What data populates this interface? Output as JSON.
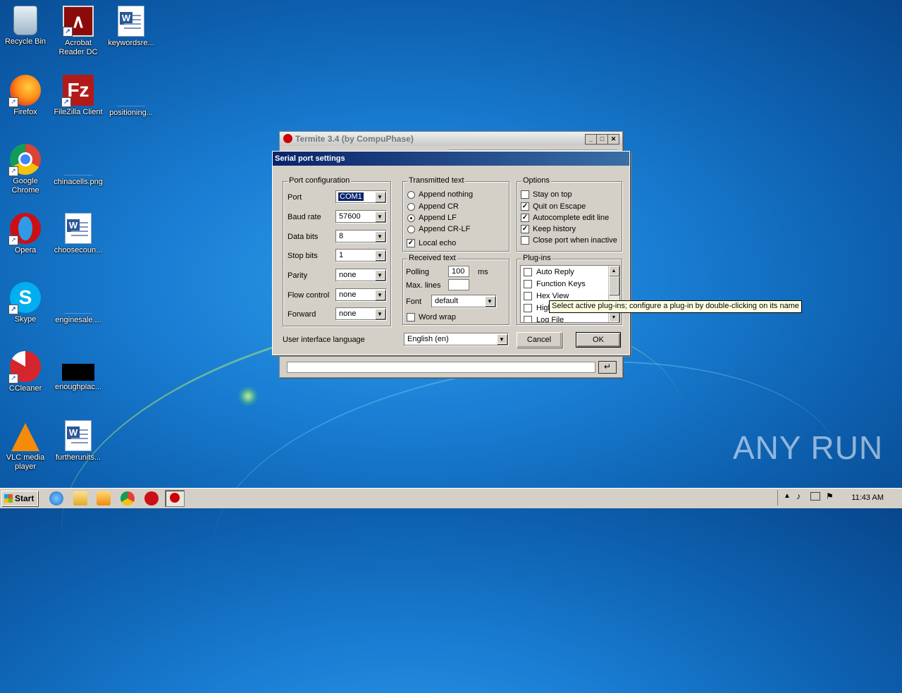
{
  "desktop": {
    "icons": [
      {
        "label": "Recycle Bin",
        "icon": "recycle-bin-icon"
      },
      {
        "label": "Acrobat Reader DC",
        "icon": "acrobat-icon"
      },
      {
        "label": "keywordsre...",
        "icon": "word-document-icon"
      },
      {
        "label": "Firefox",
        "icon": "firefox-icon"
      },
      {
        "label": "FileZilla Client",
        "icon": "filezilla-icon"
      },
      {
        "label": "positioning...",
        "icon": "file-icon"
      },
      {
        "label": "Google Chrome",
        "icon": "chrome-icon"
      },
      {
        "label": "chinacells.png",
        "icon": "image-file-icon"
      },
      {
        "label": "Opera",
        "icon": "opera-icon"
      },
      {
        "label": "choosecoun...",
        "icon": "word-document-icon"
      },
      {
        "label": "Skype",
        "icon": "skype-icon"
      },
      {
        "label": "enginesale....",
        "icon": "file-icon"
      },
      {
        "label": "CCleaner",
        "icon": "ccleaner-icon"
      },
      {
        "label": "enoughplac...",
        "icon": "image-file-icon"
      },
      {
        "label": "VLC media player",
        "icon": "vlc-icon"
      },
      {
        "label": "furtherunits...",
        "icon": "word-document-icon"
      }
    ]
  },
  "termite": {
    "title": "Termite 3.4 (by CompuPhase)",
    "enter_glyph": "↵"
  },
  "dialog": {
    "title": "Serial port settings",
    "port_config": {
      "legend": "Port configuration",
      "port_label": "Port",
      "port_value": "COM1",
      "baud_label": "Baud rate",
      "baud_value": "57600",
      "databits_label": "Data bits",
      "databits_value": "8",
      "stopbits_label": "Stop bits",
      "stopbits_value": "1",
      "parity_label": "Parity",
      "parity_value": "none",
      "flow_label": "Flow control",
      "flow_value": "none",
      "forward_label": "Forward",
      "forward_value": "none"
    },
    "transmitted": {
      "legend": "Transmitted text",
      "options": [
        "Append nothing",
        "Append CR",
        "Append LF",
        "Append CR-LF"
      ],
      "selected_index": 2,
      "local_echo": "Local echo",
      "local_echo_checked": true
    },
    "received": {
      "legend": "Received text",
      "polling_label": "Polling",
      "polling_value": "100",
      "polling_unit": "ms",
      "maxlines_label": "Max. lines",
      "maxlines_value": "",
      "font_label": "Font",
      "font_value": "default",
      "wordwrap_label": "Word wrap",
      "wordwrap_checked": false
    },
    "options": {
      "legend": "Options",
      "items": [
        {
          "label": "Stay on top",
          "checked": false
        },
        {
          "label": "Quit on Escape",
          "checked": true
        },
        {
          "label": "Autocomplete edit line",
          "checked": true
        },
        {
          "label": "Keep history",
          "checked": true
        },
        {
          "label": "Close port when inactive",
          "checked": false
        }
      ]
    },
    "plugins": {
      "legend": "Plug-ins",
      "items": [
        "Auto Reply",
        "Function Keys",
        "Hex View",
        "High",
        "Log File"
      ]
    },
    "ui_language_label": "User interface language",
    "ui_language_value": "English (en)",
    "cancel_label": "Cancel",
    "ok_label": "OK",
    "tooltip": "Select active plug-ins; configure a plug-in by double-clicking on its name"
  },
  "taskbar": {
    "start_label": "Start",
    "clock": "11:43 AM",
    "pinned": [
      "internet-explorer-icon",
      "explorer-icon",
      "media-player-icon",
      "chrome-icon",
      "opera-icon",
      "termite-icon"
    ]
  },
  "watermark": "ANY RUN",
  "colors": {
    "desktop_blue": "#1a7fd4",
    "title_active": "#0a246a",
    "window_face": "#d4d0c8"
  }
}
